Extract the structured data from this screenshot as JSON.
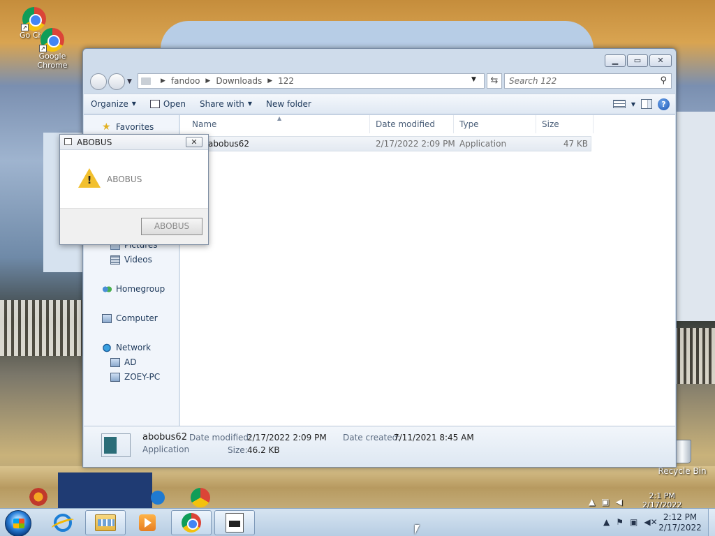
{
  "desktop": {
    "icons": [
      {
        "label": "Go Ch"
      },
      {
        "label": "Google Chrome"
      }
    ],
    "recycle_bin": "Recycle Bin",
    "ghost_clock": {
      "time": "2:1 PM",
      "date": "2/17/2022"
    }
  },
  "explorer": {
    "breadcrumbs": [
      "fandoo",
      "Downloads",
      "122"
    ],
    "search": {
      "placeholder": "Search 122"
    },
    "toolbar": {
      "organize": "Organize",
      "open": "Open",
      "share_with": "Share with",
      "new_folder": "New folder"
    },
    "nav": {
      "favorites": "Favorites",
      "pictures": "Pictures",
      "videos": "Videos",
      "homegroup": "Homegroup",
      "computer": "Computer",
      "network": "Network",
      "network_children": [
        "AD",
        "ZOEY-PC"
      ]
    },
    "columns": {
      "name": "Name",
      "date_modified": "Date modified",
      "type": "Type",
      "size": "Size"
    },
    "files": [
      {
        "name": "abobus62",
        "date_modified": "2/17/2022 2:09 PM",
        "type": "Application",
        "size": "47 KB"
      }
    ],
    "details": {
      "name": "abobus62",
      "type": "Application",
      "date_modified_label": "Date modified:",
      "date_modified": "2/17/2022 2:09 PM",
      "size_label": "Size:",
      "size": "46.2 KB",
      "date_created_label": "Date created:",
      "date_created": "7/11/2021 8:45 AM"
    }
  },
  "dialog": {
    "title": "ABOBUS",
    "message": "ABOBUS",
    "button": "ABOBUS",
    "close_glyph": "✕"
  },
  "taskbar": {
    "clock": {
      "time": "2:12 PM",
      "date": "2/17/2022"
    }
  }
}
